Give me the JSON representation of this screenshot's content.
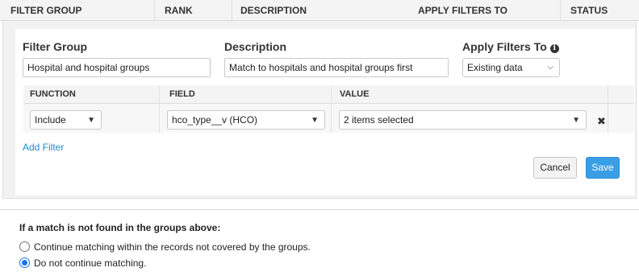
{
  "columns": {
    "filter_group": "FILTER GROUP",
    "rank": "RANK",
    "description": "DESCRIPTION",
    "apply_filters_to": "APPLY FILTERS TO",
    "status": "STATUS"
  },
  "editor": {
    "filter_group_label": "Filter Group",
    "filter_group_value": "Hospital and hospital groups",
    "description_label": "Description",
    "description_value": "Match to hospitals and hospital groups first",
    "apply_label": "Apply Filters To",
    "apply_selected": "Existing data",
    "info_glyph": "i",
    "grid": {
      "headers": {
        "function": "FUNCTION",
        "field": "FIELD",
        "value": "VALUE"
      },
      "row": {
        "function": "Include",
        "field": "hco_type__v (HCO)",
        "value": "2 items selected",
        "remove_glyph": "✖"
      }
    },
    "add_filter": "Add Filter",
    "cancel": "Cancel",
    "save": "Save"
  },
  "fallback": {
    "question": "If a match is not found in the groups above:",
    "options": [
      {
        "label": "Continue matching within the records not covered by the groups.",
        "checked": false
      },
      {
        "label": "Do not continue matching.",
        "checked": true
      }
    ]
  },
  "colors": {
    "accent": "#3a9ee4",
    "link": "#1b8bc7",
    "radio": "#1a73e8"
  }
}
